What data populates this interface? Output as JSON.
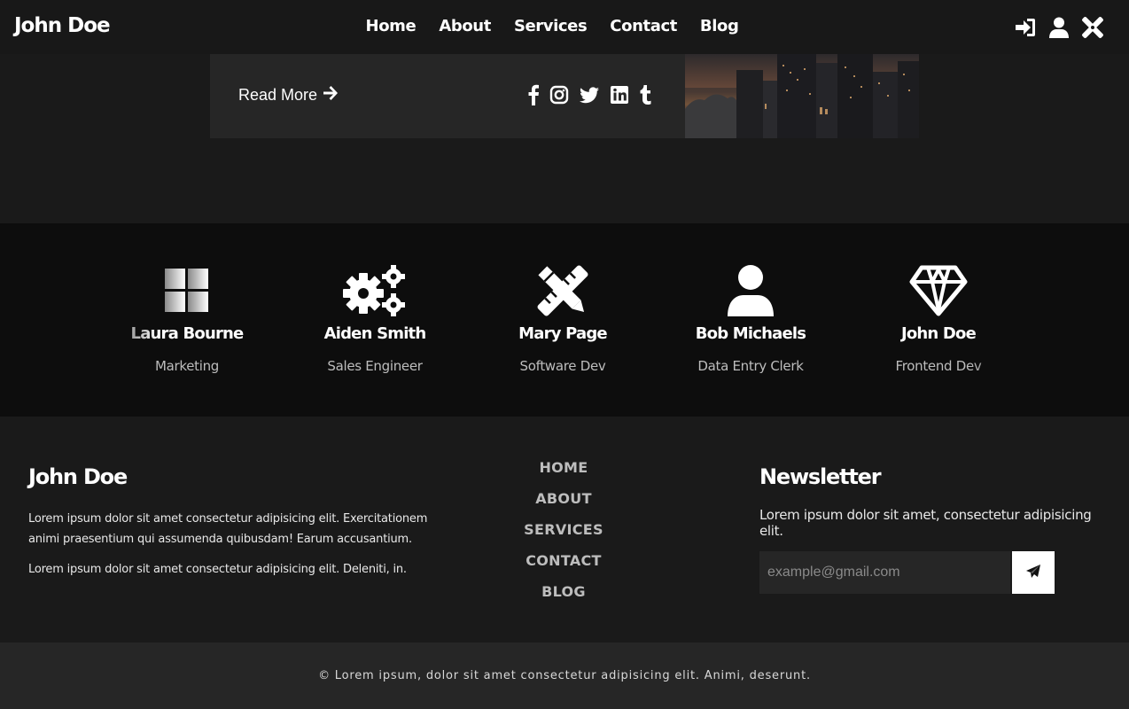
{
  "navbar": {
    "brand": "John Doe",
    "links": [
      "Home",
      "About",
      "Services",
      "Contact",
      "Blog"
    ],
    "icons": [
      "sign-in-icon",
      "user-icon",
      "tools-icon"
    ]
  },
  "post_card": {
    "read_more": "Read More",
    "social_icons": [
      "facebook-icon",
      "instagram-icon",
      "twitter-icon",
      "linkedin-icon",
      "tumblr-icon"
    ]
  },
  "team": [
    {
      "name": "Laura Bourne",
      "role": "Marketing",
      "icon": "windows-icon"
    },
    {
      "name": "Aiden Smith",
      "role": "Sales Engineer",
      "icon": "gears-icon"
    },
    {
      "name": "Mary Page",
      "role": "Software Dev",
      "icon": "tools-icon"
    },
    {
      "name": "Bob Michaels",
      "role": "Data Entry Clerk",
      "icon": "user-icon"
    },
    {
      "name": "John Doe",
      "role": "Frontend Dev",
      "icon": "gem-icon"
    }
  ],
  "footer": {
    "title": "John Doe",
    "paragraph1": "Lorem ipsum dolor sit amet consectetur adipisicing elit. Exercitationem animi praesentium qui assumenda quibusdam! Earum accusantium.",
    "paragraph2": "Lorem ipsum dolor sit amet consectetur adipisicing elit. Deleniti, in.",
    "links": [
      "HOME",
      "ABOUT",
      "SERVICES",
      "CONTACT",
      "BLOG"
    ],
    "newsletter": {
      "title": "Newsletter",
      "text": "Lorem ipsum dolor sit amet, consectetur adipisicing elit.",
      "placeholder": "example@gmail.com",
      "button_icon": "paper-plane-icon"
    },
    "copyright": "© Lorem ipsum, dolor sit amet consectetur adipisicing elit. Animi, deserunt."
  },
  "colors": {
    "background": "#1a1a1a",
    "navbar": "#181818",
    "card": "#262626",
    "team_strip": "#0d0d0d",
    "copyright_bar": "#262626",
    "muted_text": "#bdbdbd"
  }
}
